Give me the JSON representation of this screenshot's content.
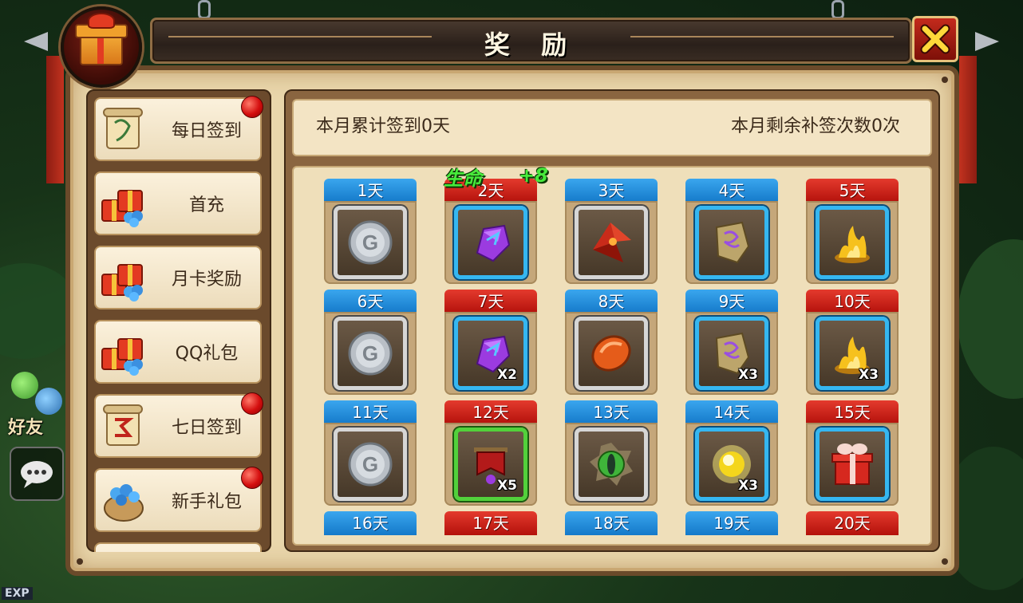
{
  "window": {
    "title": "奖 励"
  },
  "menu": {
    "items": [
      {
        "label": "每日签到",
        "badge": true,
        "icon": "scroll-icon"
      },
      {
        "label": "首充",
        "badge": false,
        "icon": "gift-boxes-icon"
      },
      {
        "label": "月卡奖励",
        "badge": false,
        "icon": "gift-boxes-icon"
      },
      {
        "label": "QQ礼包",
        "badge": false,
        "icon": "gift-boxes-icon"
      },
      {
        "label": "七日签到",
        "badge": true,
        "icon": "red-scroll-icon"
      },
      {
        "label": "新手礼包",
        "badge": true,
        "icon": "gem-sack-icon"
      }
    ]
  },
  "signin": {
    "cumulative": "本月累计签到0天",
    "remaining": "本月剩余补签次数0次"
  },
  "float_reward": {
    "label": "生命",
    "value": "+8"
  },
  "days": [
    {
      "label": "1天",
      "tab": "blue",
      "frame": "silver",
      "icon": "silver-coin-icon",
      "qty": ""
    },
    {
      "label": "2天",
      "tab": "red",
      "frame": "blue",
      "icon": "purple-crystal-icon",
      "qty": ""
    },
    {
      "label": "3天",
      "tab": "blue",
      "frame": "silver",
      "icon": "red-shard-icon",
      "qty": ""
    },
    {
      "label": "4天",
      "tab": "blue",
      "frame": "blue",
      "icon": "rune-stone-icon",
      "qty": ""
    },
    {
      "label": "5天",
      "tab": "red",
      "frame": "blue",
      "icon": "gold-flame-icon",
      "qty": ""
    },
    {
      "label": "6天",
      "tab": "blue",
      "frame": "silver",
      "icon": "silver-coin-icon",
      "qty": ""
    },
    {
      "label": "7天",
      "tab": "red",
      "frame": "blue",
      "icon": "purple-crystal-icon",
      "qty": "X2"
    },
    {
      "label": "8天",
      "tab": "blue",
      "frame": "silver",
      "icon": "orange-gem-icon",
      "qty": ""
    },
    {
      "label": "9天",
      "tab": "blue",
      "frame": "blue",
      "icon": "rune-stone-icon",
      "qty": "X3"
    },
    {
      "label": "10天",
      "tab": "red",
      "frame": "blue",
      "icon": "gold-flame-icon",
      "qty": "X3"
    },
    {
      "label": "11天",
      "tab": "blue",
      "frame": "silver",
      "icon": "silver-coin-icon",
      "qty": ""
    },
    {
      "label": "12天",
      "tab": "red",
      "frame": "green",
      "icon": "red-banner-icon",
      "qty": "X5"
    },
    {
      "label": "13天",
      "tab": "blue",
      "frame": "silver",
      "icon": "green-orb-icon",
      "qty": ""
    },
    {
      "label": "14天",
      "tab": "blue",
      "frame": "blue",
      "icon": "gold-orb-icon",
      "qty": "X3"
    },
    {
      "label": "15天",
      "tab": "red",
      "frame": "blue",
      "icon": "gift-box-icon",
      "qty": ""
    },
    {
      "label": "16天",
      "tab": "blue",
      "frame": "",
      "icon": "",
      "qty": ""
    },
    {
      "label": "17天",
      "tab": "red",
      "frame": "",
      "icon": "",
      "qty": ""
    },
    {
      "label": "18天",
      "tab": "blue",
      "frame": "",
      "icon": "",
      "qty": ""
    },
    {
      "label": "19天",
      "tab": "blue",
      "frame": "",
      "icon": "",
      "qty": ""
    },
    {
      "label": "20天",
      "tab": "red",
      "frame": "",
      "icon": "",
      "qty": ""
    }
  ],
  "hud": {
    "friends_label": "好友",
    "exp_label": "EXP"
  }
}
